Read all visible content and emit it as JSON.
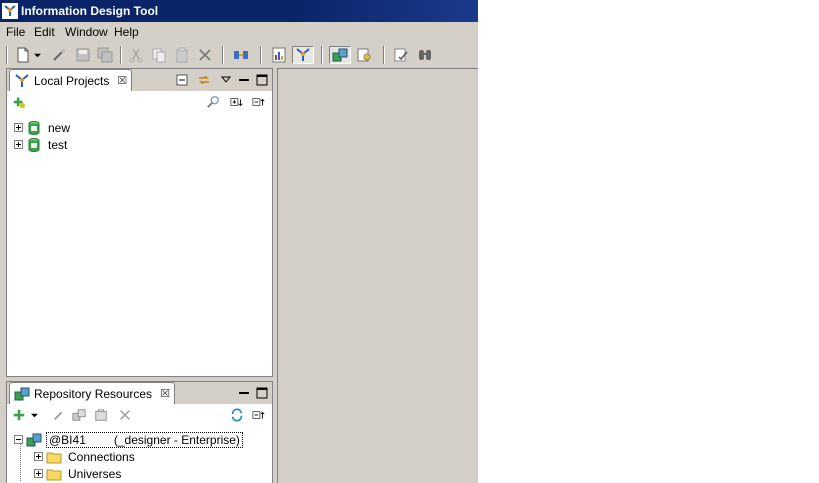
{
  "window": {
    "title": "Information Design Tool"
  },
  "menu": {
    "items": [
      "File",
      "Edit",
      "Window",
      "Help"
    ]
  },
  "toolbar": {
    "icons": [
      "new-icon",
      "dropdown-arrow-icon",
      "wand-icon",
      "save-icon",
      "save-all-icon",
      "cut-icon",
      "copy-icon",
      "paste-icon",
      "delete-icon",
      "connect-icon",
      "report-icon",
      "perspective-icon",
      "repository-icon",
      "security-icon",
      "check-integrity-icon",
      "find-icon"
    ]
  },
  "local_projects": {
    "tab_label": "Local Projects",
    "items": [
      {
        "label": "new",
        "icon": "project-icon",
        "expanded": false
      },
      {
        "label": "test",
        "icon": "project-icon",
        "expanded": false
      }
    ]
  },
  "repository": {
    "tab_label": "Repository Resources",
    "session": {
      "label": "@BI41",
      "user": "(_designer - Enterprise)",
      "expanded": true
    },
    "children": [
      {
        "label": "Connections",
        "icon": "folder-icon",
        "expanded": false
      },
      {
        "label": "Universes",
        "icon": "folder-icon",
        "expanded": false
      }
    ]
  },
  "colors": {
    "titlebar": "#0a246a",
    "chrome": "#d4d0c8",
    "folder": "#f7d860",
    "project": "#3aa34a"
  }
}
